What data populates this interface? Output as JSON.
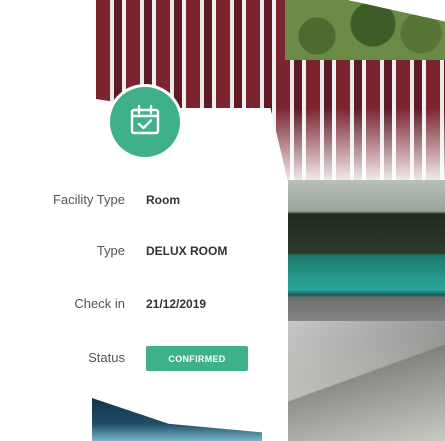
{
  "icons": {
    "badge": "calendar-check-icon"
  },
  "colors": {
    "accent": "#3fb189",
    "label": "#555555",
    "value": "#333333"
  },
  "booking": {
    "facility_type": {
      "label": "Facility Type",
      "value": "Room"
    },
    "type": {
      "label": "Type",
      "value": "DELUX ROOM"
    },
    "check_in": {
      "label": "Check in",
      "value": "21/12/2019"
    },
    "status": {
      "label": "Status",
      "value": "CONFIRMED"
    }
  }
}
